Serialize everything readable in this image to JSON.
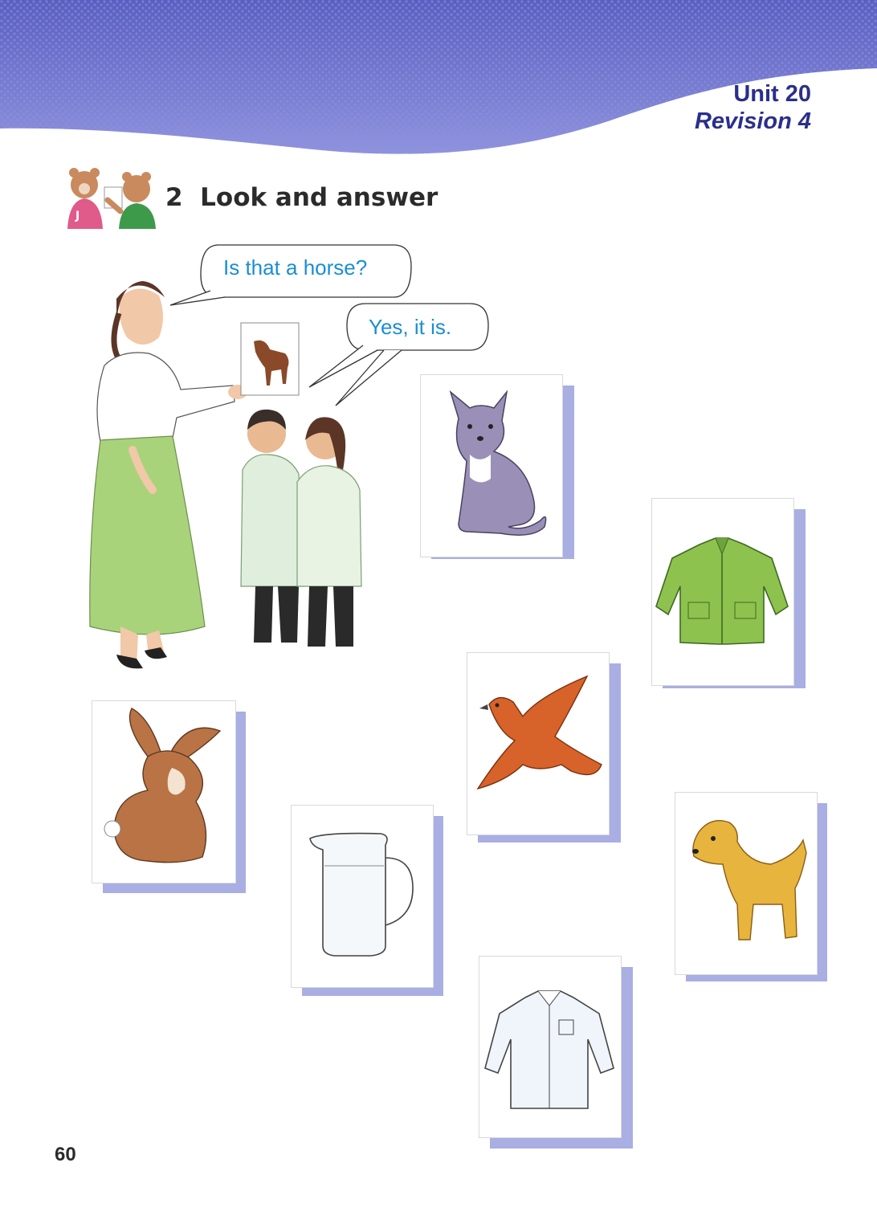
{
  "header": {
    "unit": "Unit 20",
    "revision": "Revision 4"
  },
  "section": {
    "title": "2  Look and answer",
    "icon": "bears-pointing-icon"
  },
  "dialogue": {
    "question": "Is that a horse?",
    "answer": "Yes, it is."
  },
  "cards": [
    "horse",
    "cat",
    "coat",
    "rabbit",
    "bird",
    "jug",
    "dog",
    "shirt"
  ],
  "colors": {
    "header_band": "#6b6fc9",
    "heading": "#2a2f8c",
    "bubble_text": "#1b8ed2",
    "card_shadow": "#a9aee3"
  },
  "page_number": "60"
}
